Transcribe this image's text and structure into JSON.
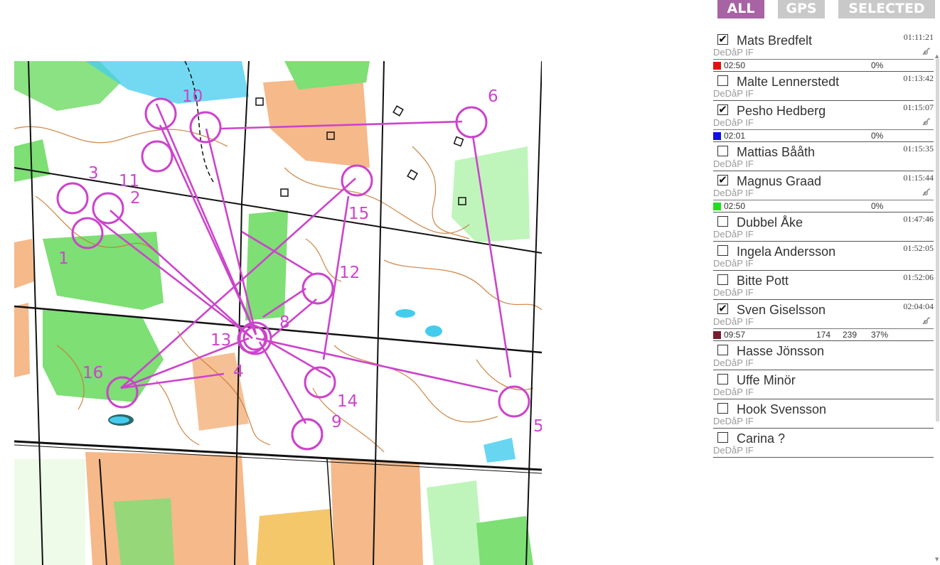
{
  "filter_tabs": {
    "all": "ALL",
    "gps": "GPS",
    "selected": "SELECTED"
  },
  "colors": {
    "tab_active": "#a763a3",
    "tab_inactive": "#c9c9c9",
    "course_overprint": "#cc44cc",
    "forest": "#7ddf74",
    "open_land": "#f5b98a",
    "water": "#44ccee",
    "contour": "#c87a35"
  },
  "map": {
    "controls": [
      {
        "n": "1"
      },
      {
        "n": "2"
      },
      {
        "n": "3"
      },
      {
        "n": "4"
      },
      {
        "n": "5"
      },
      {
        "n": "6"
      },
      {
        "n": "8"
      },
      {
        "n": "9"
      },
      {
        "n": "10"
      },
      {
        "n": "11"
      },
      {
        "n": "12"
      },
      {
        "n": "13"
      },
      {
        "n": "14"
      },
      {
        "n": "15"
      },
      {
        "n": "16"
      }
    ]
  },
  "runners": [
    {
      "checked": true,
      "name": "Mats Bredfelt",
      "club": "DeDåP IF",
      "time": "01:11:21",
      "gps": true,
      "color": "#e31010",
      "tail": "02:50",
      "s1": "",
      "s2": "",
      "pct": "0%"
    },
    {
      "checked": false,
      "name": "Malte Lennerstedt",
      "club": "DeDåP IF",
      "time": "01:13:42",
      "gps": false
    },
    {
      "checked": true,
      "name": "Pesho Hedberg",
      "club": "DeDåP IF",
      "time": "01:15:07",
      "gps": true,
      "color": "#1010e3",
      "tail": "02:01",
      "s1": "",
      "s2": "",
      "pct": "0%"
    },
    {
      "checked": false,
      "name": "Mattias Bååth",
      "club": "DeDåP IF",
      "time": "01:15:35",
      "gps": false
    },
    {
      "checked": true,
      "name": "Magnus Graad",
      "club": "DeDåP IF",
      "time": "01:15:44",
      "gps": true,
      "color": "#22dd22",
      "tail": "02:50",
      "s1": "",
      "s2": "",
      "pct": "0%"
    },
    {
      "checked": false,
      "name": "Dubbel Åke",
      "club": "DeDåP IF",
      "time": "01:47:46",
      "gps": false
    },
    {
      "checked": false,
      "name": "Ingela Andersson",
      "club": "DeDåP IF",
      "time": "01:52:05",
      "gps": false
    },
    {
      "checked": false,
      "name": "Bitte Pott",
      "club": "DeDåP IF",
      "time": "01:52:06",
      "gps": false
    },
    {
      "checked": true,
      "name": "Sven Giselsson",
      "club": "DeDåP IF",
      "time": "02:04:04",
      "gps": true,
      "color": "#7a1c2c",
      "tail": "09:57",
      "s1": "174",
      "s2": "239",
      "pct": "37%"
    },
    {
      "checked": false,
      "name": "Hasse Jönsson",
      "club": "DeDåP IF",
      "time": "",
      "gps": false
    },
    {
      "checked": false,
      "name": "Uffe Minör",
      "club": "DeDåP IF",
      "time": "",
      "gps": false
    },
    {
      "checked": false,
      "name": "Hook Svensson",
      "club": "DeDåP IF",
      "time": "",
      "gps": false
    },
    {
      "checked": false,
      "name": "Carina ?",
      "club": "DeDåP IF",
      "time": "",
      "gps": false
    }
  ]
}
